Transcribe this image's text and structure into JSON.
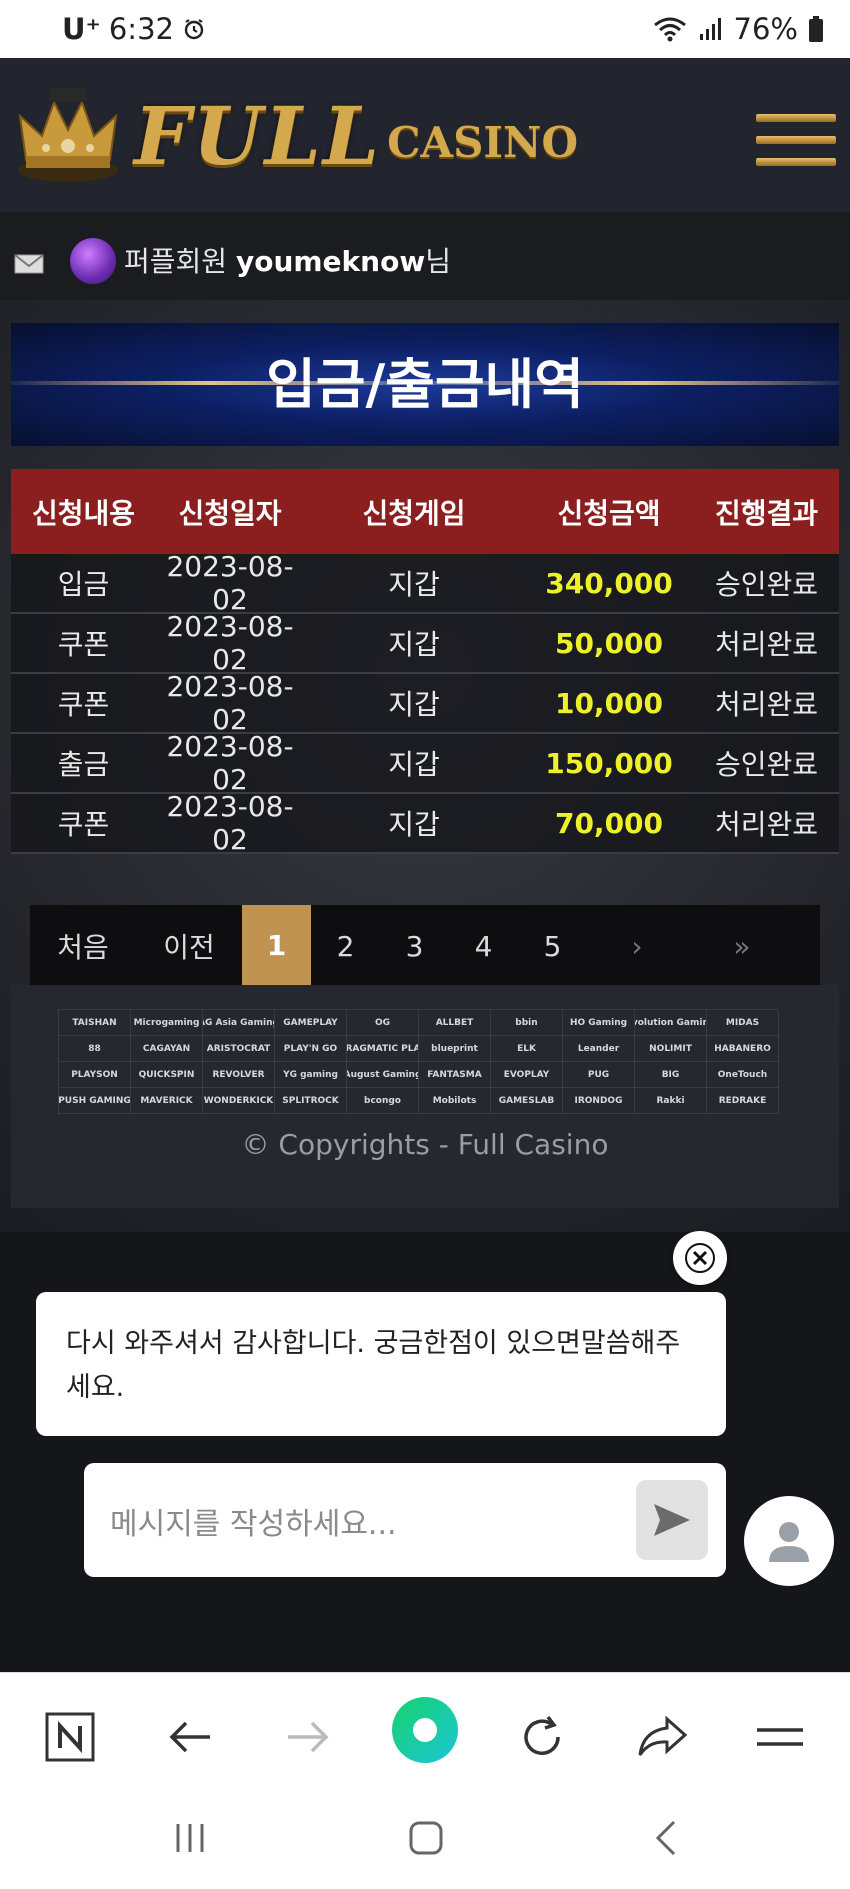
{
  "status_bar": {
    "carrier": "U⁺",
    "time": "6:32",
    "battery": "76%"
  },
  "header": {
    "logo_full": "FULL",
    "logo_casino": "CASINO"
  },
  "user": {
    "grade": "퍼플회원",
    "username": "youmeknow",
    "suffix": "님"
  },
  "page_title": "입금/출금내역",
  "table": {
    "headers": [
      "신청내용",
      "신청일자",
      "신청게임",
      "신청금액",
      "진행결과"
    ],
    "rows": [
      {
        "type": "입금",
        "date": "2023-08-02",
        "game": "지갑",
        "amount": "340,000",
        "result": "승인완료"
      },
      {
        "type": "쿠폰",
        "date": "2023-08-02",
        "game": "지갑",
        "amount": "50,000",
        "result": "처리완료"
      },
      {
        "type": "쿠폰",
        "date": "2023-08-02",
        "game": "지갑",
        "amount": "10,000",
        "result": "처리완료"
      },
      {
        "type": "출금",
        "date": "2023-08-02",
        "game": "지갑",
        "amount": "150,000",
        "result": "승인완료"
      },
      {
        "type": "쿠폰",
        "date": "2023-08-02",
        "game": "지갑",
        "amount": "70,000",
        "result": "처리완료"
      }
    ]
  },
  "pagination": {
    "first": "처음",
    "prev": "이전",
    "pages": [
      "1",
      "2",
      "3",
      "4",
      "5"
    ],
    "active": "1",
    "next": "›",
    "last": "»"
  },
  "providers": [
    "TAISHAN",
    "Microgaming",
    "AG Asia Gaming",
    "GAMEPLAY",
    "OG",
    "ALLBET",
    "bbin",
    "HO Gaming",
    "Evolution Gaming",
    "MIDAS",
    "88",
    "CAGAYAN",
    "ARISTOCRAT",
    "PLAY'N GO",
    "PRAGMATIC PLAY",
    "blueprint",
    "ELK",
    "Leander",
    "NOLIMIT",
    "HABANERO",
    "PLAYSON",
    "QUICKSPIN",
    "REVOLVER",
    "YG gaming",
    "August Gaming",
    "FANTASMA",
    "EVOPLAY",
    "PUG",
    "BIG",
    "OneTouch",
    "PUSH GAMING",
    "MAVERICK",
    "WONDERKICK",
    "SPLITROCK",
    "bcongo",
    "Mobilots",
    "GAMESLAB",
    "IRONDOG",
    "Rakki",
    "REDRAKE"
  ],
  "copyright": "© Copyrights - Full Casino",
  "chat": {
    "message": "다시 와주셔서 감사합니다. 궁금한점이 있으면말씀해주세요.",
    "input_placeholder": "메시지를 작성하세요..."
  },
  "colors": {
    "header_bg": "#23252e",
    "table_header": "#8b1f1f",
    "amount": "#eef02a",
    "pager_active": "#c09350",
    "banner": "#0d1f63"
  }
}
